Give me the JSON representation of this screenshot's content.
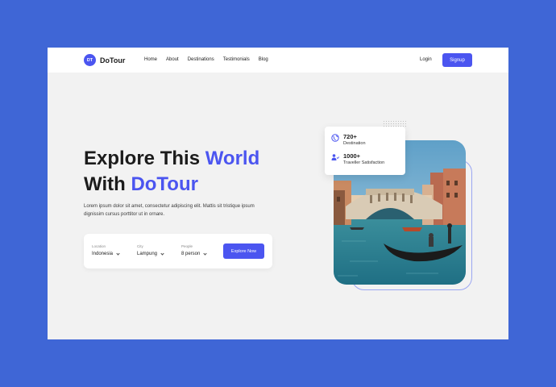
{
  "brand": {
    "badge": "DT",
    "name": "DoTour"
  },
  "nav": {
    "items": [
      "Home",
      "About",
      "Destinations",
      "Testimonials",
      "Blog"
    ],
    "login": "Login",
    "signup": "Signup"
  },
  "hero": {
    "line1_plain": "Explore This ",
    "line1_accent": "World",
    "line2_plain": "With ",
    "line2_accent": "DoTour",
    "description": "Lorem ipsum dolor sit amet, consectetur adipiscing elit. Mattis sit tristique ipsum dignissim cursus porttitor ut in ornare."
  },
  "search": {
    "location_label": "Location",
    "location_value": "Indonesia",
    "city_label": "City",
    "city_value": "Lampung",
    "people_label": "People",
    "people_value": "8 person",
    "button": "Explore Now"
  },
  "stats": [
    {
      "icon": "globe-icon",
      "value": "720+",
      "label": "Destination"
    },
    {
      "icon": "users-icon",
      "value": "1000+",
      "label": "Traveller Satisfaction"
    }
  ],
  "colors": {
    "accent": "#4b55f0",
    "background": "#3f66d6",
    "page": "#f2f2f2"
  }
}
